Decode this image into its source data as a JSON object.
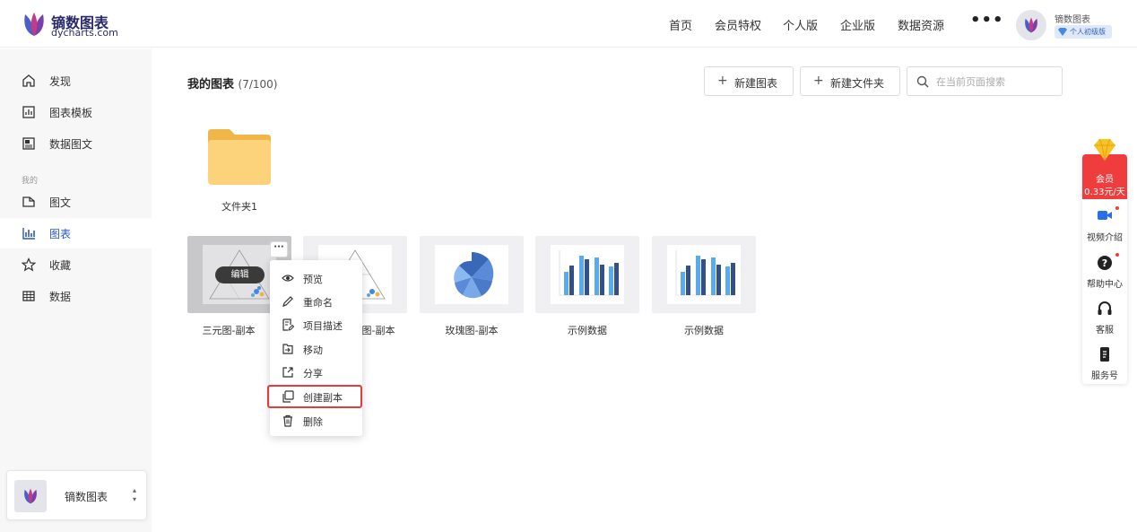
{
  "brand": {
    "name": "镝数图表",
    "domain": "dycharts.com",
    "colors": {
      "primary": "#2a56c6",
      "accent_red": "#ef3d3d",
      "logo_purple": "#5b3fa8"
    }
  },
  "nav": {
    "items": [
      "首页",
      "会员特权",
      "个人版",
      "企业版",
      "数据资源"
    ],
    "more": "•••"
  },
  "user": {
    "name": "镝数图表",
    "badge": "个人初级版"
  },
  "sidebar": {
    "top_items": [
      {
        "label": "发现",
        "icon": "home-icon"
      },
      {
        "label": "图表模板",
        "icon": "chart-template-icon"
      },
      {
        "label": "数据图文",
        "icon": "data-article-icon"
      }
    ],
    "group_label": "我的",
    "my_items": [
      {
        "label": "图文",
        "icon": "article-icon"
      },
      {
        "label": "图表",
        "icon": "bar-chart-icon",
        "active": true
      },
      {
        "label": "收藏",
        "icon": "star-icon"
      },
      {
        "label": "数据",
        "icon": "table-icon"
      }
    ],
    "account": {
      "name": "镝数图表",
      "switch": "▴▾"
    }
  },
  "main": {
    "title": "我的图表",
    "count": "(7/100)",
    "buttons": {
      "new_chart": "新建图表",
      "new_folder": "新建文件夹"
    },
    "search": {
      "placeholder": "在当前页面搜索",
      "value": ""
    },
    "folder": {
      "label": "文件夹1"
    },
    "charts": [
      {
        "label": "三元图-副本",
        "thumb": "ternary"
      },
      {
        "label": "三元图-副本",
        "thumb": "ternary"
      },
      {
        "label": "玫瑰图-副本",
        "thumb": "rose"
      },
      {
        "label": "示例数据",
        "thumb": "bar"
      },
      {
        "label": "示例数据",
        "thumb": "bar"
      }
    ],
    "edit_label": "编辑",
    "more_label": "···"
  },
  "context_menu": {
    "items": [
      {
        "label": "预览",
        "icon": "eye-icon"
      },
      {
        "label": "重命名",
        "icon": "pencil-icon"
      },
      {
        "label": "项目描述",
        "icon": "description-icon"
      },
      {
        "label": "移动",
        "icon": "move-icon"
      },
      {
        "label": "分享",
        "icon": "share-icon"
      },
      {
        "label": "创建副本",
        "icon": "copy-icon",
        "highlighted": true
      },
      {
        "label": "删除",
        "icon": "trash-icon"
      }
    ]
  },
  "float_panel": {
    "vip": {
      "line1": "会员",
      "line2": "0.33元/天"
    },
    "items": [
      {
        "label": "视频介绍",
        "icon": "video-icon"
      },
      {
        "label": "帮助中心",
        "icon": "help-icon"
      },
      {
        "label": "客服",
        "icon": "headset-icon"
      },
      {
        "label": "服务号",
        "icon": "service-account-icon"
      }
    ]
  }
}
